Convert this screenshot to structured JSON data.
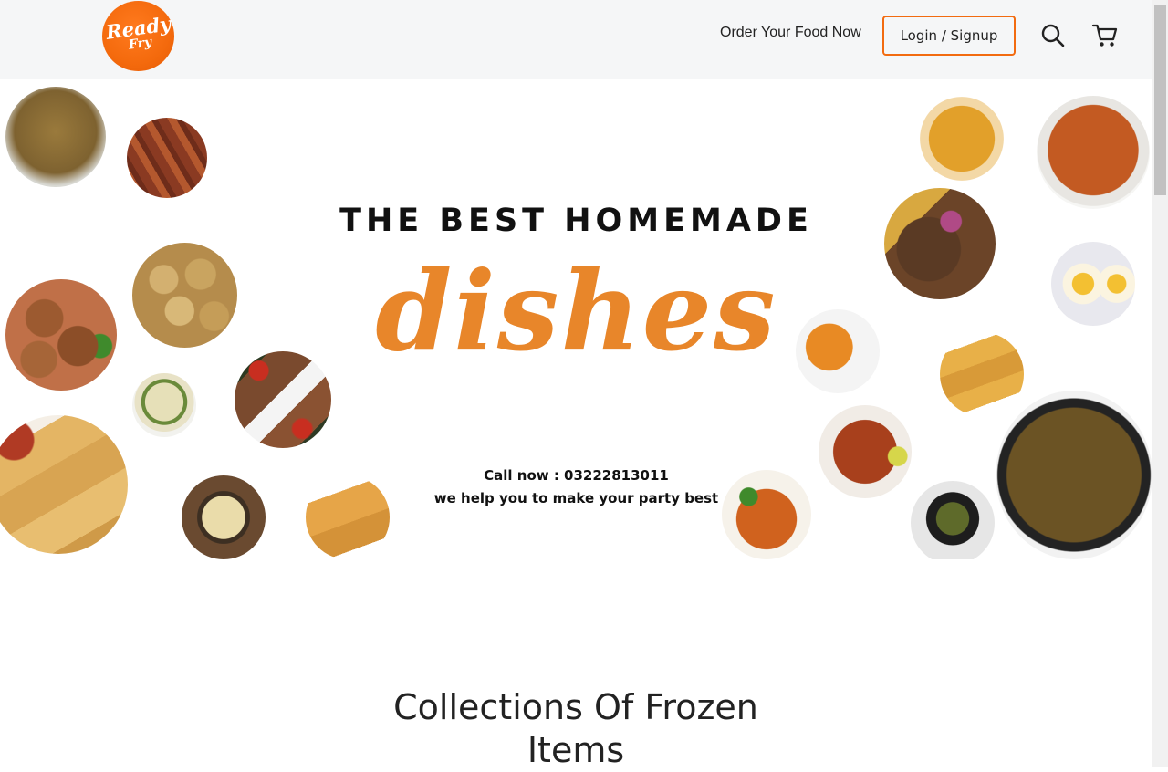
{
  "header": {
    "logo_line1": "Ready",
    "logo_line2": "Fry",
    "nav_link": "Order Your Food Now",
    "login_label": "Login / Signup",
    "search_icon": "search-icon",
    "cart_icon": "cart-icon"
  },
  "hero": {
    "title": "THE BEST HOMEMADE",
    "script": "dishes",
    "call": "Call now : 03222813011",
    "tagline": "we help you to make your party best"
  },
  "section": {
    "title": "Collections Of Frozen Items"
  },
  "colors": {
    "accent": "#f26b10",
    "script": "#e8862a",
    "header_bg": "#f5f6f7"
  }
}
